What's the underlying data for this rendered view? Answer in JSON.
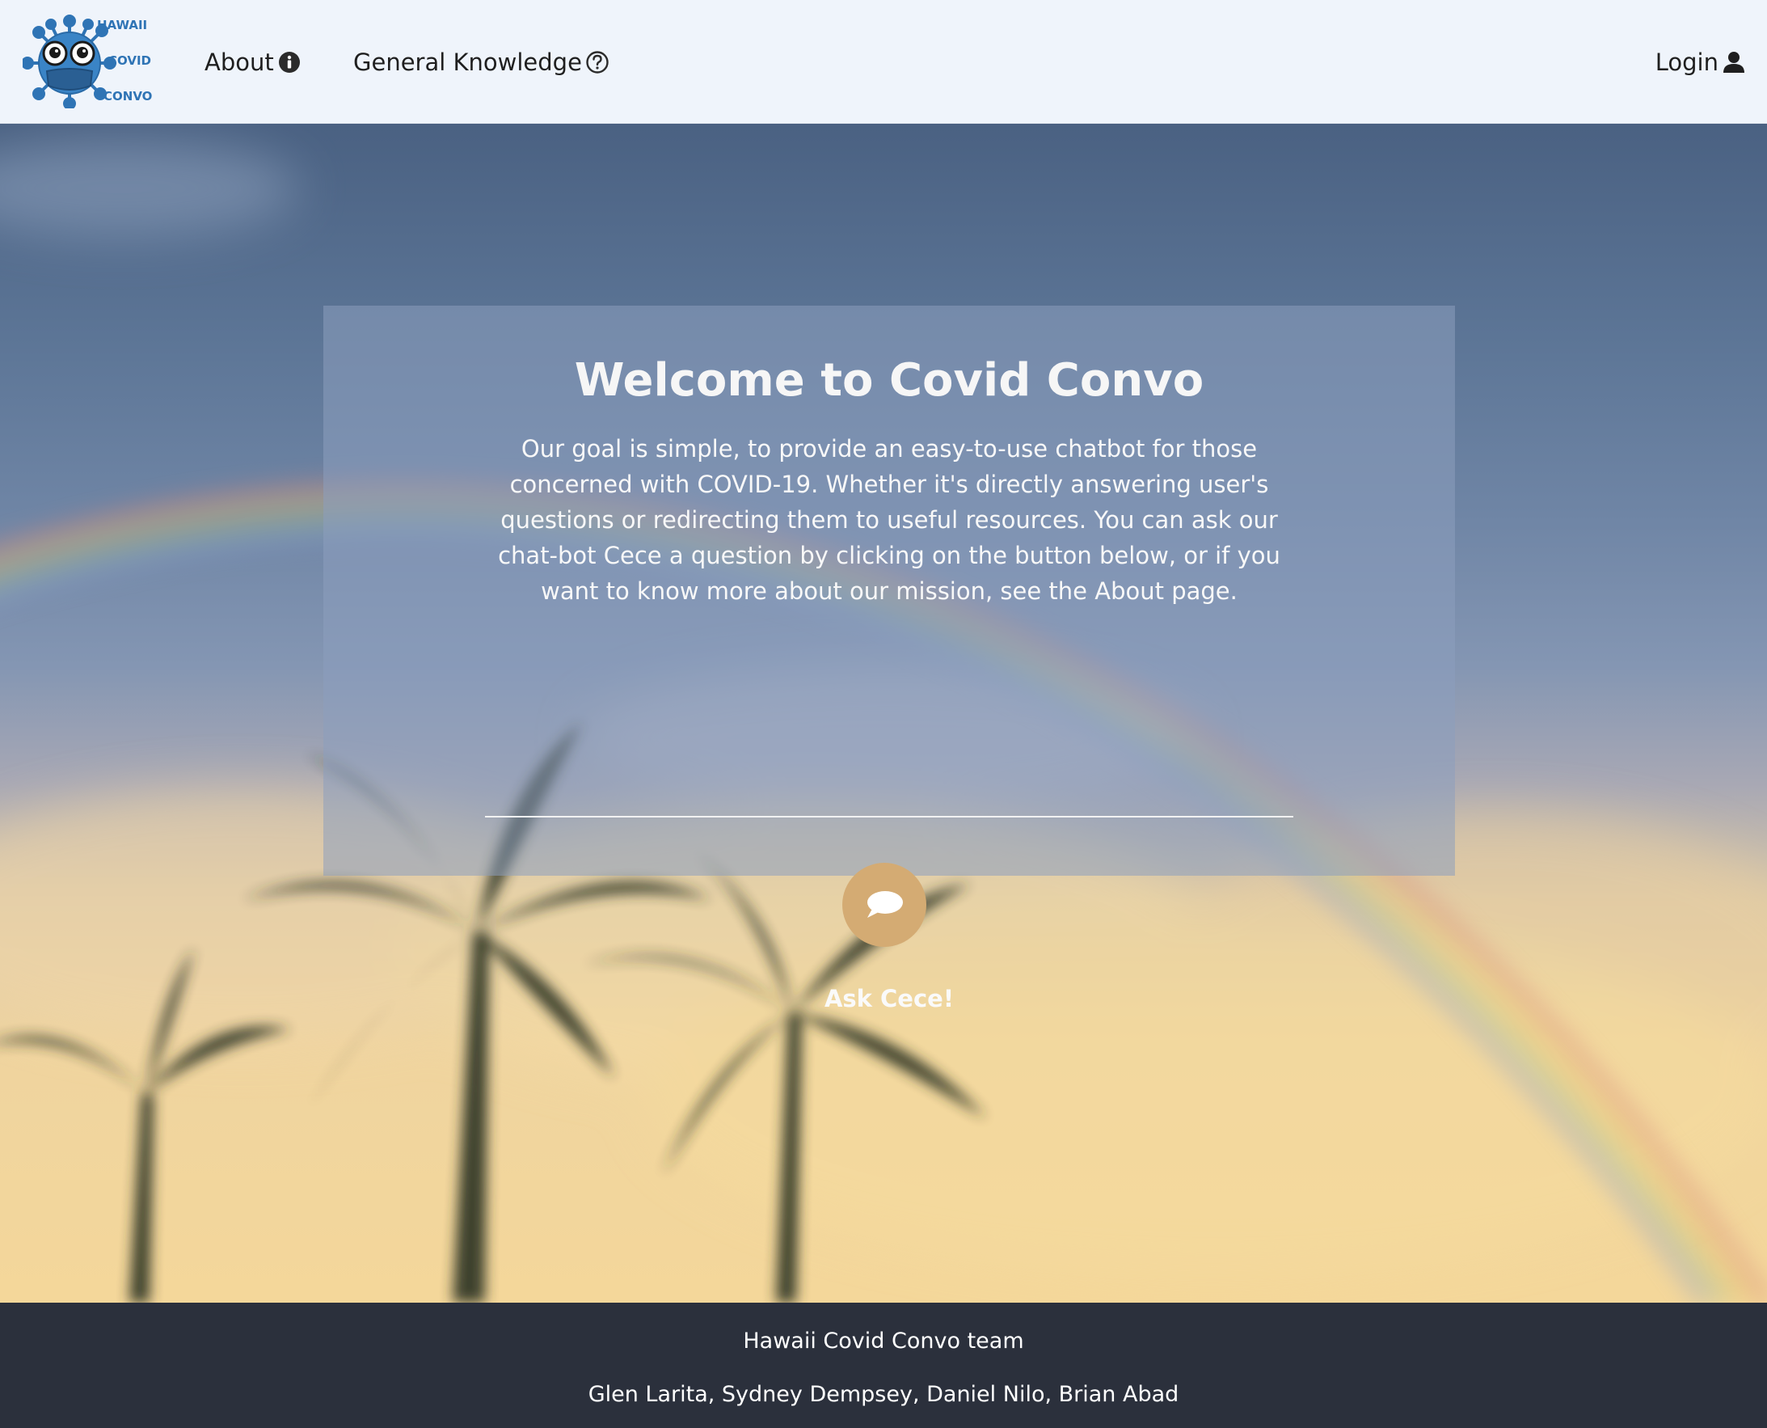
{
  "navbar": {
    "logo": {
      "line1": "HAWAII",
      "line2": "COVID",
      "line3": "CONVO"
    },
    "links": [
      {
        "label": "About",
        "icon": "info-circle-icon"
      },
      {
        "label": "General Knowledge",
        "icon": "question-circle-icon"
      }
    ],
    "login": {
      "label": "Login",
      "icon": "user-icon"
    }
  },
  "hero": {
    "title": "Welcome to Covid Convo",
    "description": "Our goal is simple, to provide an easy-to-use chatbot for those concerned with COVID-19. Whether it's directly answering user's questions or redirecting them to useful resources. You can ask our chat-bot Cece a question by clicking on the button below, or if you want to know more about our mission, see the About page.",
    "chat_button_icon": "chat-bubble-icon",
    "ask_label": "Ask Cece!"
  },
  "footer": {
    "team": "Hawaii Covid Convo team",
    "members": "Glen Larita, Sydney Dempsey, Daniel Nilo, Brian Abad"
  },
  "colors": {
    "navbar_bg": "#eff4fb",
    "card_bg": "rgba(140,158,190,0.55)",
    "chat_button": "#d4ab73",
    "footer_bg": "#2b303c",
    "logo_blue": "#2f74b5"
  }
}
